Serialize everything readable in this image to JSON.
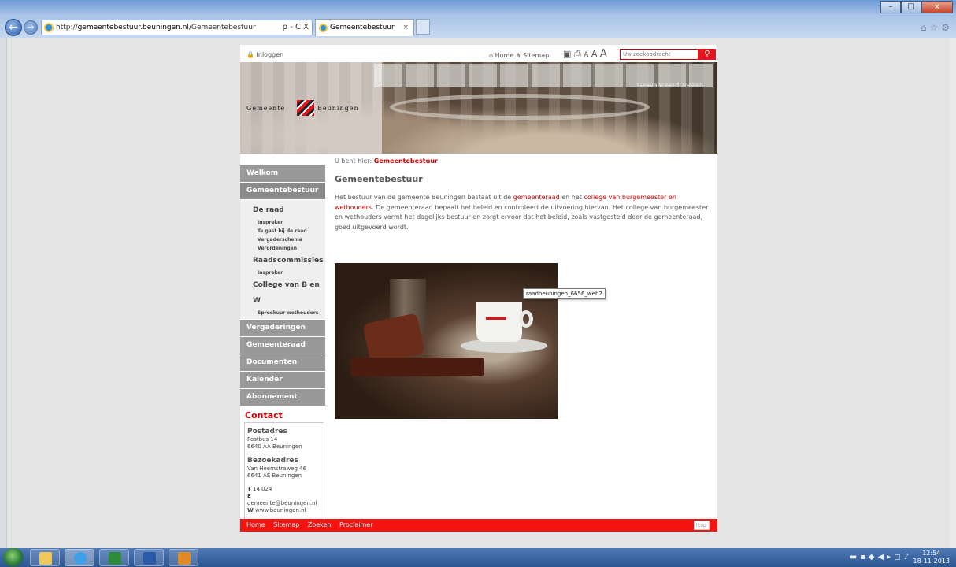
{
  "browser": {
    "url": "http://gemeentebestuur.beuningen.nl/Gemeentebestuur",
    "url_host": "gemeentebestuur.beuningen.nl",
    "url_path": "/Gemeentebestuur",
    "address_tools": "ρ - C X",
    "tab_title": "Gemeentebestuur",
    "tab_close": "×",
    "back": "←",
    "forward": "→"
  },
  "window_controls": {
    "minimize": "–",
    "maximize": "□",
    "close": "x"
  },
  "topbar": {
    "login": "Inloggen",
    "home": "Home",
    "sitemap": "Sitemap",
    "text_sizes": [
      "A",
      "A",
      "A"
    ],
    "search_placeholder": "Uw zoekopdracht",
    "search_button_icon": "magnifier-icon",
    "advanced": "Geavanceerd zoeken"
  },
  "logo": {
    "left": "Gemeente",
    "right": "Beuningen"
  },
  "breadcrumb": {
    "prefix": "U bent hier:",
    "current": "Gemeentebestuur"
  },
  "sidebar": {
    "items": [
      {
        "label": "Welkom"
      },
      {
        "label": "Gemeentebestuur"
      }
    ],
    "sub": [
      {
        "label": "De raad"
      },
      {
        "label": "Inspreken",
        "level": 3
      },
      {
        "label": "Te gast bij de raad",
        "level": 3
      },
      {
        "label": "Vergaderschema",
        "level": 3
      },
      {
        "label": "Verordeningen",
        "level": 3
      },
      {
        "label": "Raadscommissies"
      },
      {
        "label": "Inspreken",
        "level": 3
      },
      {
        "label": "College van B en W"
      },
      {
        "label": "Spreekuur wethouders",
        "level": 3
      }
    ],
    "items_after": [
      {
        "label": "Vergaderingen"
      },
      {
        "label": "Gemeenteraad"
      },
      {
        "label": "Documenten"
      },
      {
        "label": "Kalender"
      },
      {
        "label": "Abonnement"
      }
    ]
  },
  "contact": {
    "title": "Contact",
    "postadres_label": "Postadres",
    "postadres_1": "Postbus 14",
    "postadres_2": "6640 AA Beuningen",
    "bezoekadres_label": "Bezoekadres",
    "bezoekadres_1": "Van Heemstraweg 46",
    "bezoekadres_2": "6641 AE Beuningen",
    "t_label": "T",
    "t": "14 024",
    "e_label": "E",
    "e": "gemeente@beuningen.nl",
    "w_label": "W",
    "w": "www.beuningen.nl"
  },
  "content": {
    "title": "Gemeentebestuur",
    "p1": "Het bestuur van de gemeente Beuningen bestaat uit de ",
    "link1": "gemeenteraad",
    "p2": " en het ",
    "link2": "college van burgemeester en wethouders",
    "p3": ". De gemeenteraad bepaalt het beleid en controleert de uitvoering hiervan. Het college van burgemeester en wethouders vormt het dagelijks bestuur en zorgt ervoor dat het beleid, zoals vastgesteld door de gemeenteraad, goed uitgevoerd wordt.",
    "image_tooltip": "raadbeuningen_6656_web2"
  },
  "footer": {
    "links": [
      "Home",
      "Sitemap",
      "Zoeken",
      "Proclaimer"
    ],
    "top": "top"
  },
  "taskbar": {
    "time": "12:54",
    "date": "18-11-2013",
    "apps": [
      "explorer-icon",
      "internet-explorer-icon",
      "excel-icon",
      "word-icon",
      "outlook-icon"
    ]
  }
}
